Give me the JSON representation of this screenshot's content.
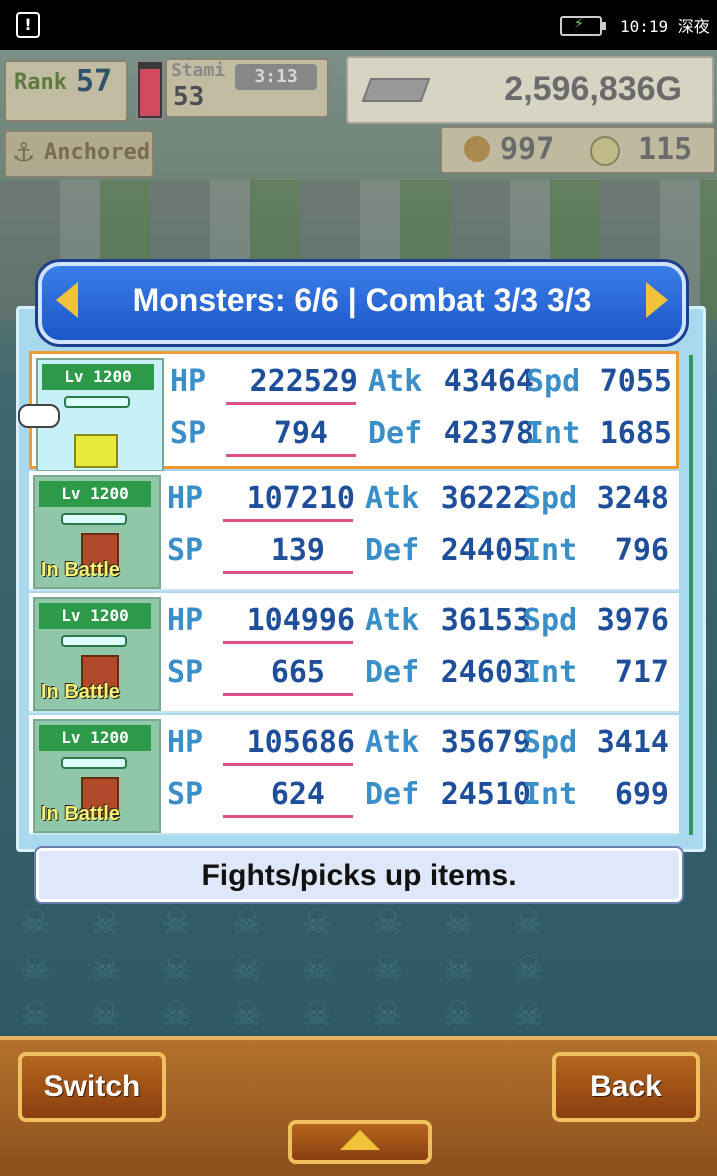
{
  "status_bar": {
    "alert_icon": "!",
    "clock": "10:19 深夜"
  },
  "hud": {
    "rank_label": "Rank",
    "rank_value": "57",
    "stamina_label": "Stami",
    "stamina_value": "53",
    "stamina_fill_fraction": 0.9,
    "timer": "3:13",
    "gold": "2,596,836G",
    "anchored_label": "Anchored",
    "coins": "997",
    "medals": "115"
  },
  "panel": {
    "title": "Monsters: 6/6 | Combat 3/3  3/3",
    "description": "Fights/picks up items.",
    "monsters": [
      {
        "level": "Lv 1200",
        "battle_tag": "",
        "hp": "222529",
        "sp": "794",
        "atk": "43464",
        "def": "42378",
        "spd": "7055",
        "int": "1685",
        "selected": true
      },
      {
        "level": "Lv 1200",
        "battle_tag": "In Battle",
        "hp": "107210",
        "sp": "139",
        "atk": "36222",
        "def": "24405",
        "spd": "3248",
        "int": "796",
        "selected": false
      },
      {
        "level": "Lv 1200",
        "battle_tag": "In Battle",
        "hp": "104996",
        "sp": "665",
        "atk": "36153",
        "def": "24603",
        "spd": "3976",
        "int": "717",
        "selected": false
      },
      {
        "level": "Lv 1200",
        "battle_tag": "In Battle",
        "hp": "105686",
        "sp": "624",
        "atk": "35679",
        "def": "24510",
        "spd": "3414",
        "int": "699",
        "selected": false
      }
    ],
    "stat_labels": {
      "hp": "HP",
      "sp": "SP",
      "atk": "Atk",
      "def": "Def",
      "spd": "Spd",
      "int": "Int"
    }
  },
  "buttons": {
    "switch": "Switch",
    "back": "Back"
  },
  "colors": {
    "accent": "#1c56c8",
    "selection": "#f19a33",
    "stat_value": "#1f4f9a"
  }
}
